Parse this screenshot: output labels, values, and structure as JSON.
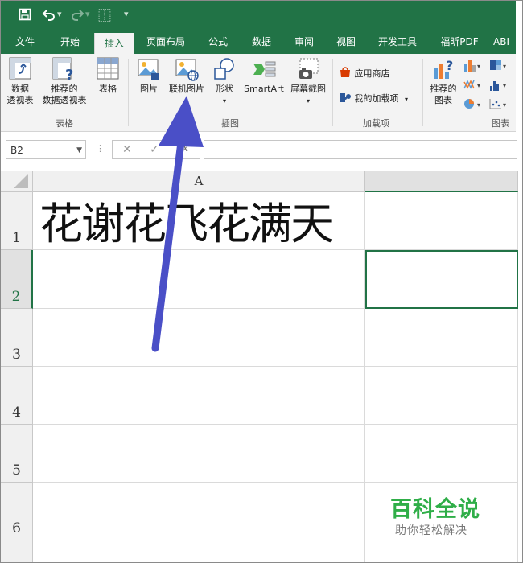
{
  "qat": {
    "save_icon": "save-icon",
    "undo_icon": "undo-icon",
    "redo_icon": "redo-icon",
    "custom_glyph": "⿰",
    "more_icon": "customize-qat-icon"
  },
  "tabs": [
    {
      "label": "文件"
    },
    {
      "label": "开始"
    },
    {
      "label": "插入"
    },
    {
      "label": "页面布局"
    },
    {
      "label": "公式"
    },
    {
      "label": "数据"
    },
    {
      "label": "审阅"
    },
    {
      "label": "视图"
    },
    {
      "label": "开发工具"
    },
    {
      "label": "福昕PDF"
    },
    {
      "label": "ABI"
    }
  ],
  "ribbon": {
    "pivot_label_1": "数据",
    "pivot_label_2": "透视表",
    "rec_pivot_label_1": "推荐的",
    "rec_pivot_label_2": "数据透视表",
    "table_label": "表格",
    "group_tables": "表格",
    "picture_label": "图片",
    "online_picture_label": "联机图片",
    "shapes_label": "形状",
    "smartart_label": "SmartArt",
    "screenshot_label": "屏幕截图",
    "group_illustrations": "插图",
    "store_label": "应用商店",
    "my_addins_label": "我的加载项",
    "group_addins": "加载项",
    "rec_charts_label_1": "推荐的",
    "rec_charts_label_2": "图表",
    "group_charts": "图表"
  },
  "formula_bar": {
    "name_box": "B2",
    "fx": "fx",
    "formula_value": ""
  },
  "sheet": {
    "columns": [
      "A"
    ],
    "rows": [
      "1",
      "2",
      "3",
      "4",
      "5",
      "6"
    ],
    "a1": "花谢花飞花满天",
    "selected_cell": "B2"
  },
  "watermark": {
    "title": "百科全说",
    "subtitle": "助你轻松解决"
  },
  "colors": {
    "accent": "#217346",
    "arrow": "#4a4fc7",
    "watermark": "#2fae48"
  }
}
